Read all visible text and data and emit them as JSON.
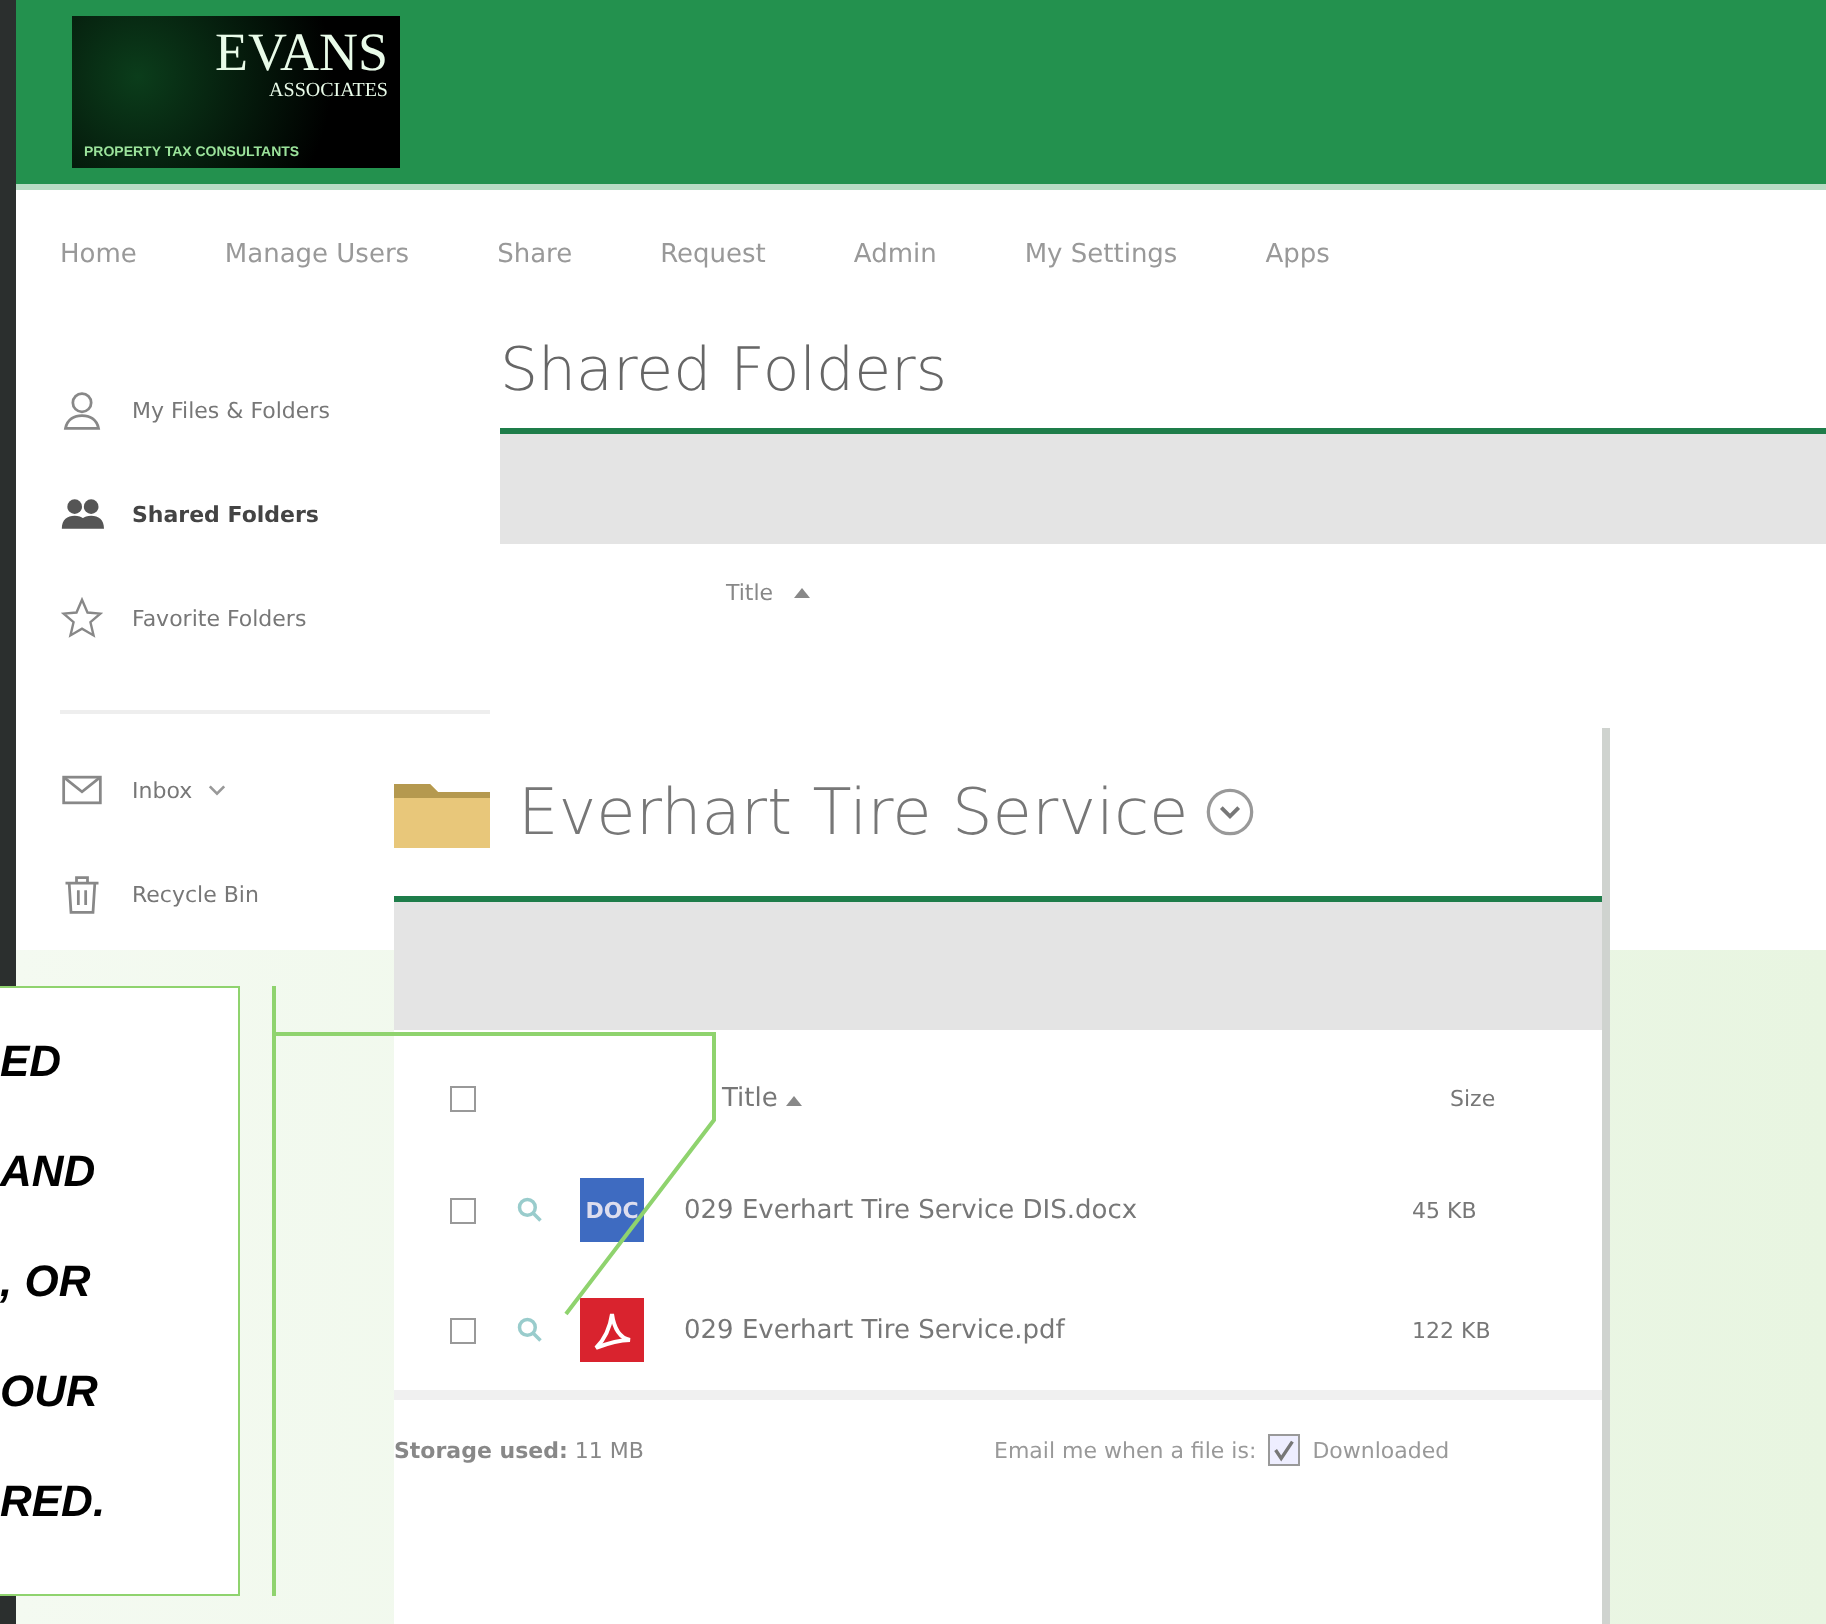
{
  "logo": {
    "name": "EVANS",
    "sub": "ASSOCIATES",
    "tagline": "PROPERTY TAX CONSULTANTS"
  },
  "nav": [
    "Home",
    "Manage Users",
    "Share",
    "Request",
    "Admin",
    "My Settings",
    "Apps"
  ],
  "sidebar": {
    "items": [
      {
        "label": "My Files & Folders",
        "kind": "person",
        "selected": false
      },
      {
        "label": "Shared Folders",
        "kind": "people",
        "selected": true
      },
      {
        "label": "Favorite Folders",
        "kind": "star",
        "selected": false
      }
    ],
    "secondary": [
      {
        "label": "Inbox",
        "kind": "mail",
        "expandable": true
      },
      {
        "label": "Recycle Bin",
        "kind": "trash",
        "expandable": false
      }
    ]
  },
  "main": {
    "title": "Shared Folders",
    "column": "Title"
  },
  "folder_panel": {
    "title": "Everhart Tire Service",
    "columns": [
      "Title",
      "Size"
    ],
    "select_all_checked": false,
    "rows": [
      {
        "checked": false,
        "kind": "doc",
        "type_label": "DOC",
        "name": "029 Everhart Tire Service DIS.docx",
        "size": "45 KB"
      },
      {
        "checked": false,
        "kind": "pdf",
        "name": "029 Everhart Tire Service.pdf",
        "size": "122 KB"
      }
    ],
    "storage": "**Storage used:** 11 MB",
    "email_label": "Email me when a file is:",
    "email_option": {
      "label": "Downloaded",
      "checked": true
    }
  },
  "callout": [
    "ED",
    "AND",
    ", OR",
    "OUR",
    "RED."
  ]
}
